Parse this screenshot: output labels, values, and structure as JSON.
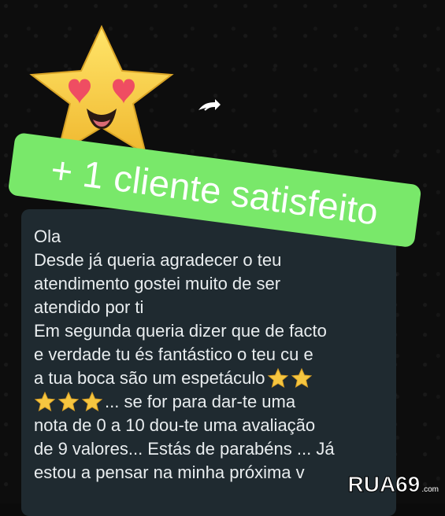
{
  "forward_icon": "forward-icon",
  "banner": {
    "text": "+ 1 cliente satisfeito",
    "background": "#79e86a",
    "text_color": "#ffffff"
  },
  "message": {
    "lines": [
      "Ola",
      "Desde já queria agradecer o teu",
      "atendimento gostei muito de ser",
      "atendido por ti",
      "Em segunda queria dizer que de facto",
      "e verdade tu és fantástico o teu cu e",
      "a tua boca são um espetáculo",
      "... se for para dar-te uma",
      "nota de 0 a 10 dou-te uma avaliação",
      "de 9 valores... Estás de parabéns ... Já",
      "estou a pensar na minha próxima v"
    ]
  },
  "watermark": {
    "brand": "RUA69",
    "domain": ".com"
  },
  "colors": {
    "background": "#0b0b0b",
    "bubble": "#1f2a30",
    "text": "#e9edef",
    "star": "#f6c640",
    "heart": "#f04557"
  }
}
